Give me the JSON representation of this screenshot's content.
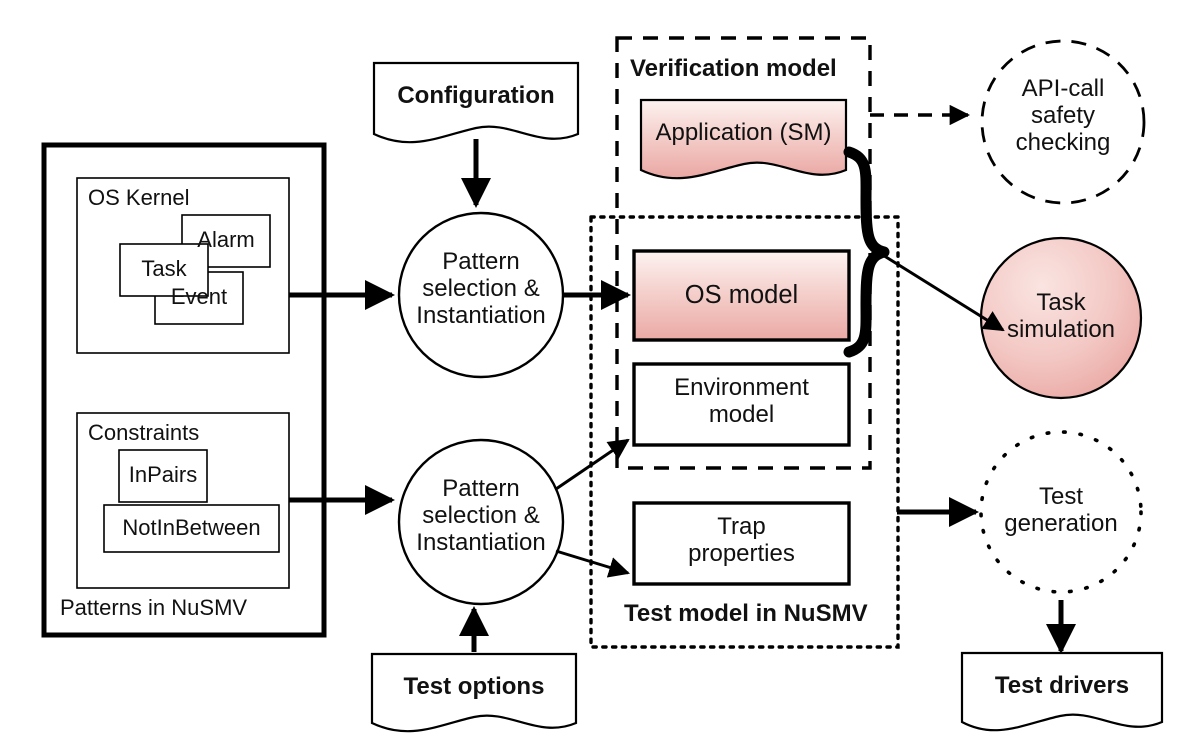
{
  "diagram": {
    "title": "OS model based test generation and verification workflow",
    "colors": {
      "stroke": "#000000",
      "background": "#ffffff",
      "pink_light": "#fbeeec",
      "pink_mid": "#f4cdc9",
      "pink_deep": "#eaa9a5",
      "text": "#111111"
    }
  },
  "patterns_container": {
    "caption": "Patterns in NuSMV",
    "os_kernel": {
      "label": "OS Kernel",
      "items": [
        {
          "label": "Alarm"
        },
        {
          "label": "Event"
        },
        {
          "label": "Task"
        }
      ]
    },
    "constraints": {
      "label": "Constraints",
      "items": [
        {
          "label": "InPairs"
        },
        {
          "label": "NotInBetween"
        }
      ]
    }
  },
  "inputs": {
    "configuration": "Configuration",
    "test_options": "Test options"
  },
  "processes": {
    "pattern_selection_top": "Pattern\nselection &\nInstantiation",
    "pattern_selection_bottom": "Pattern\nselection &\nInstantiation"
  },
  "verification_model": {
    "label": "Verification model",
    "application": "Application (SM)"
  },
  "test_model": {
    "label": "Test model in NuSMV",
    "os_model": "OS model",
    "environment_model": "Environment\nmodel",
    "trap_properties": "Trap\nproperties"
  },
  "outputs": {
    "api_call_safety_checking": "API-call\nsafety\nchecking",
    "task_simulation": "Task\nsimulation",
    "test_generation": "Test\ngeneration",
    "test_drivers": "Test drivers"
  }
}
